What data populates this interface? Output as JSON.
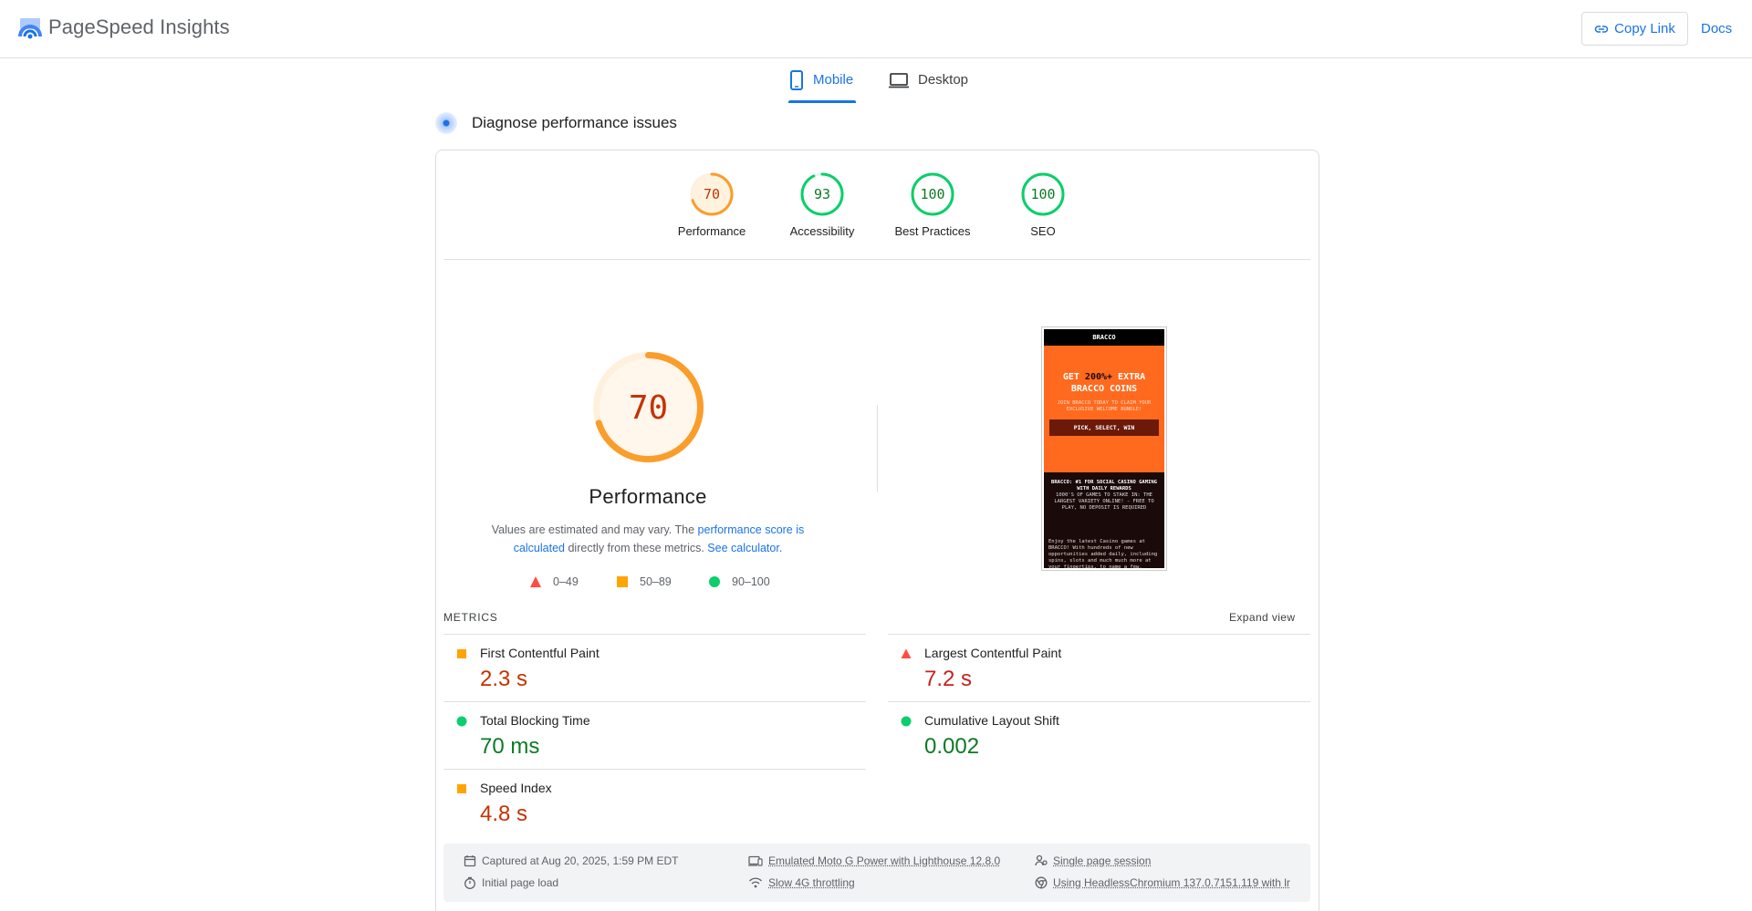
{
  "header": {
    "app_title": "PageSpeed Insights",
    "copy_link": "Copy Link",
    "docs": "Docs"
  },
  "tabs": [
    {
      "label": "Mobile",
      "active": true
    },
    {
      "label": "Desktop",
      "active": false
    }
  ],
  "diagnose": {
    "title": "Diagnose performance issues"
  },
  "category_scores": [
    {
      "label": "Performance",
      "score": "70",
      "color": "#fa9d2b"
    },
    {
      "label": "Accessibility",
      "score": "93",
      "color": "#0cce6b"
    },
    {
      "label": "Best Practices",
      "score": "100",
      "color": "#0cce6b"
    },
    {
      "label": "SEO",
      "score": "100",
      "color": "#0cce6b"
    }
  ],
  "performance": {
    "score": "70",
    "title": "Performance",
    "desc_pre": "Values are estimated and may vary. The ",
    "desc_link1": "performance score is calculated",
    "desc_mid": " directly from these metrics. ",
    "desc_link2": "See calculator."
  },
  "legend": [
    {
      "range": "0–49",
      "shape": "triangle",
      "color": "#ff4e42"
    },
    {
      "range": "50–89",
      "shape": "square",
      "color": "#ffa400"
    },
    {
      "range": "90–100",
      "shape": "circle",
      "color": "#0cce6b"
    }
  ],
  "screenshot": {
    "brand": "BRACCO",
    "hero_line1_a": "GET ",
    "hero_line1_b": "200%+",
    "hero_line1_c": " EXTRA",
    "hero_line2": "BRACCO COINS",
    "hero_sub": "JOIN BRACCO TODAY TO CLAIM YOUR EXCLUSIVE WELCOME BUNDLE!",
    "hero_button": "PICK, SELECT, WIN",
    "section_title": "BRACCO: #1 FOR SOCIAL CASINO GAMING WITH DAILY REWARDS",
    "section_text": "1000'S OF GAMES TO STAKE IN: THE LARGEST VARIETY ONLINE! - FREE TO PLAY, NO DEPOSIT IS REQUIRED",
    "body_text": "Enjoy the latest Casino games at BRACCO! With hundreds of new opportunities added daily, including spins, slots and much much more at your fingertips, to name a few."
  },
  "metrics_header": {
    "label": "METRICS",
    "expand": "Expand view"
  },
  "metrics": [
    {
      "name": "First Contentful Paint",
      "value": "2.3 s",
      "rating": "average"
    },
    {
      "name": "Largest Contentful Paint",
      "value": "7.2 s",
      "rating": "fail"
    },
    {
      "name": "Total Blocking Time",
      "value": "70 ms",
      "rating": "pass"
    },
    {
      "name": "Cumulative Layout Shift",
      "value": "0.002",
      "rating": "pass"
    },
    {
      "name": "Speed Index",
      "value": "4.8 s",
      "rating": "average"
    }
  ],
  "run_info": {
    "captured": "Captured at Aug 20, 2025, 1:59 PM EDT",
    "load": "Initial page load",
    "device": "Emulated Moto G Power with Lighthouse 12.8.0",
    "throttling": "Slow 4G throttling",
    "session": "Single page session",
    "browser": "Using HeadlessChromium 137.0.7151.119 with lr"
  }
}
